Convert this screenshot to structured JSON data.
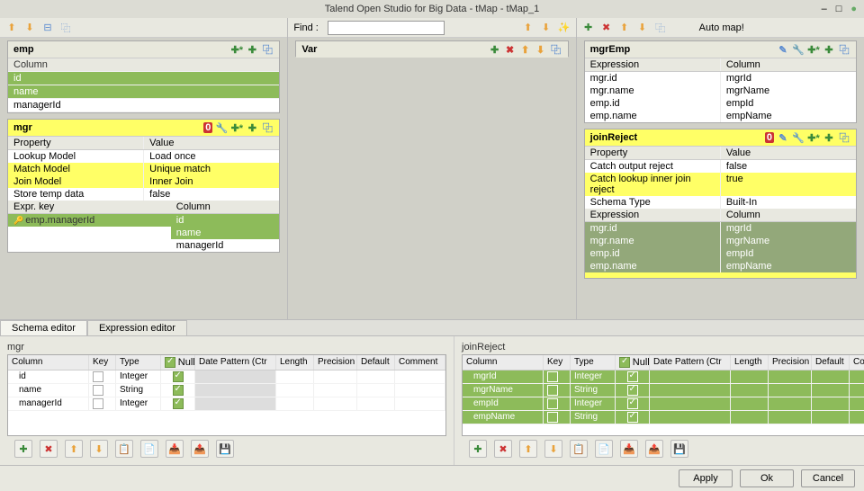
{
  "window": {
    "title": "Talend Open Studio for Big Data - tMap - tMap_1"
  },
  "input": {
    "emp": {
      "title": "emp",
      "colHeader": "Column",
      "rows": [
        "id",
        "name",
        "managerId"
      ]
    },
    "mgr": {
      "title": "mgr",
      "propHeader": {
        "p": "Property",
        "v": "Value"
      },
      "props": [
        {
          "p": "Lookup Model",
          "v": "Load once",
          "hl": ""
        },
        {
          "p": "Match Model",
          "v": "Unique match",
          "hl": "yellow"
        },
        {
          "p": "Join Model",
          "v": "Inner Join",
          "hl": "yellow"
        },
        {
          "p": "Store temp data",
          "v": "false",
          "hl": ""
        }
      ],
      "exprHeader": {
        "k": "Expr. key",
        "c": "Column"
      },
      "exprRows": [
        {
          "k": "emp.managerId",
          "c": "id",
          "hl": "green",
          "key": true
        },
        {
          "k": "",
          "c": "name",
          "hl": "green",
          "key": false
        },
        {
          "k": "",
          "c": "managerId",
          "hl": "",
          "key": false
        }
      ]
    }
  },
  "var": {
    "title": "Var",
    "findLabel": "Find :"
  },
  "output": {
    "autoMap": "Auto map!",
    "mgrEmp": {
      "title": "mgrEmp",
      "header": {
        "e": "Expression",
        "c": "Column"
      },
      "rows": [
        {
          "e": "mgr.id",
          "c": "mgrId"
        },
        {
          "e": "mgr.name",
          "c": "mgrName"
        },
        {
          "e": "emp.id",
          "c": "empId"
        },
        {
          "e": "emp.name",
          "c": "empName"
        }
      ]
    },
    "joinReject": {
      "title": "joinReject",
      "propHeader": {
        "p": "Property",
        "v": "Value"
      },
      "props": [
        {
          "p": "Catch output reject",
          "v": "false",
          "hl": ""
        },
        {
          "p": "Catch lookup inner join reject",
          "v": "true",
          "hl": "yellow"
        },
        {
          "p": "Schema Type",
          "v": "Built-In",
          "hl": ""
        }
      ],
      "header": {
        "e": "Expression",
        "c": "Column"
      },
      "rows": [
        {
          "e": "mgr.id",
          "c": "mgrId"
        },
        {
          "e": "mgr.name",
          "c": "mgrName"
        },
        {
          "e": "emp.id",
          "c": "empId"
        },
        {
          "e": "emp.name",
          "c": "empName"
        }
      ]
    }
  },
  "tabs": {
    "schema": "Schema editor",
    "expr": "Expression editor"
  },
  "schema": {
    "left": {
      "name": "mgr",
      "cols": {
        "column": "Column",
        "key": "Key",
        "type": "Type",
        "null": "Null",
        "date": "Date Pattern (Ctr",
        "len": "Length",
        "prec": "Precision",
        "def": "Default",
        "com": "Comment"
      },
      "rows": [
        {
          "col": "id",
          "type": "Integer",
          "null": true
        },
        {
          "col": "name",
          "type": "String",
          "null": true
        },
        {
          "col": "managerId",
          "type": "Integer",
          "null": true
        }
      ]
    },
    "right": {
      "name": "joinReject",
      "cols": {
        "column": "Column",
        "key": "Key",
        "type": "Type",
        "null": "Null",
        "date": "Date Pattern (Ctr",
        "len": "Length",
        "prec": "Precision",
        "def": "Default",
        "com": "Comment"
      },
      "rows": [
        {
          "col": "mgrId",
          "type": "Integer",
          "null": true
        },
        {
          "col": "mgrName",
          "type": "String",
          "null": true
        },
        {
          "col": "empId",
          "type": "Integer",
          "null": true
        },
        {
          "col": "empName",
          "type": "String",
          "null": true
        }
      ]
    }
  },
  "buttons": {
    "apply": "Apply",
    "ok": "Ok",
    "cancel": "Cancel"
  },
  "icons": {
    "plus": "✚",
    "x": "✖",
    "up": "⬆",
    "down": "⬇",
    "min": "⊟",
    "max": "⬜",
    "copy": "⿻",
    "paste": "📋",
    "save": "💾",
    "load": "📂",
    "undo": "↶",
    "redo": "↷",
    "wrench": "🔧",
    "pencil": "✎",
    "badge": "0"
  }
}
